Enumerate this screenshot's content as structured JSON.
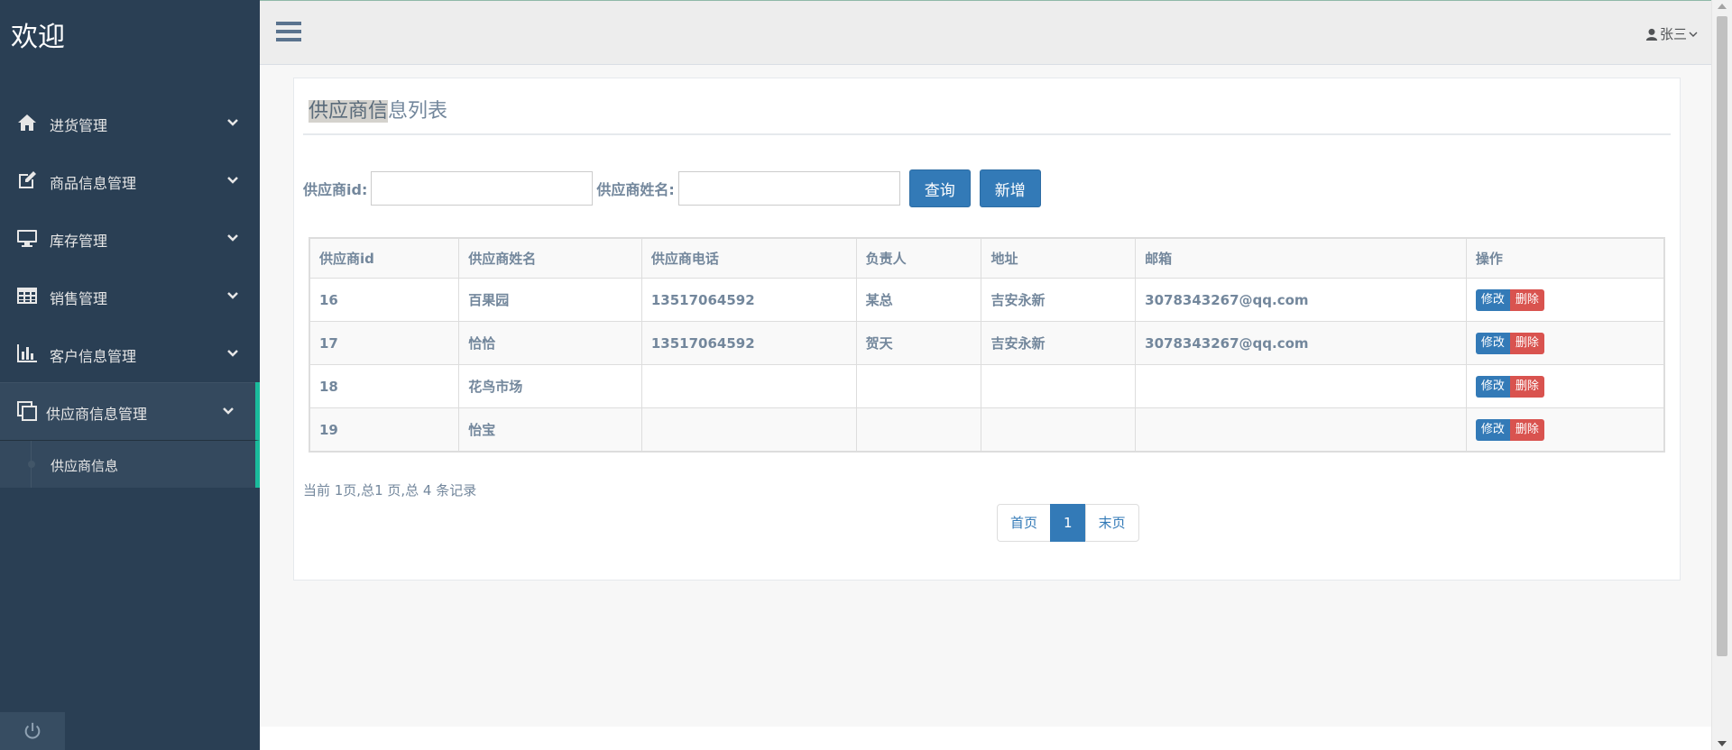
{
  "brand": "欢迎",
  "sidebar": {
    "items": [
      {
        "label": "进货管理",
        "icon": "home-icon"
      },
      {
        "label": "商品信息管理",
        "icon": "edit-icon"
      },
      {
        "label": "库存管理",
        "icon": "desktop-icon"
      },
      {
        "label": "销售管理",
        "icon": "table-icon"
      },
      {
        "label": "客户信息管理",
        "icon": "bar-chart-icon"
      },
      {
        "label": "供应商信息管理",
        "icon": "clone-icon"
      }
    ],
    "sub_item": "供应商信息"
  },
  "topbar": {
    "user_name": "张三"
  },
  "panel": {
    "title_highlight": "供应商信",
    "title_rest": "息列表"
  },
  "search": {
    "id_label": "供应商id:",
    "name_label": "供应商姓名:",
    "query_button": "查询",
    "add_button": "新增"
  },
  "table": {
    "headers": [
      "供应商id",
      "供应商姓名",
      "供应商电话",
      "负责人",
      "地址",
      "邮箱",
      "操作"
    ],
    "rows": [
      [
        "16",
        "百果园",
        "13517064592",
        "某总",
        "吉安永新",
        "3078343267@qq.com"
      ],
      [
        "17",
        "恰恰",
        "13517064592",
        "贺天",
        "吉安永新",
        "3078343267@qq.com"
      ],
      [
        "18",
        "花鸟市场",
        "",
        "",
        "",
        ""
      ],
      [
        "19",
        "怡宝",
        "",
        "",
        "",
        ""
      ]
    ],
    "edit_label": "修改",
    "delete_label": "删除"
  },
  "pagination": {
    "info": "当前 1页,总1 页,总 4 条记录",
    "first": "首页",
    "current": "1",
    "last": "末页"
  },
  "colors": {
    "sidebar_bg": "#2a3f54",
    "accent": "#1abb9c",
    "primary": "#337ab7",
    "danger": "#d9534f"
  }
}
